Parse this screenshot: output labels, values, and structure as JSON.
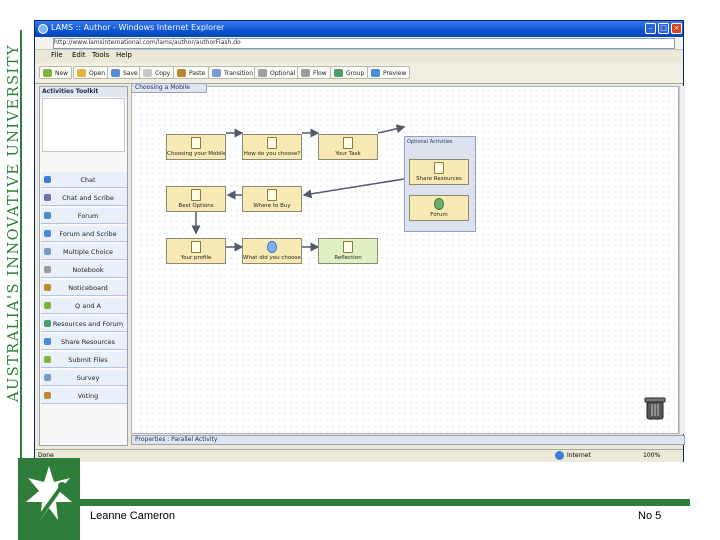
{
  "branding": {
    "university": "AUSTRALIA'S INNOVATIVE UNIVERSITY",
    "logo_icon": "university-star-logo"
  },
  "footer": {
    "presenter": "Leanne Cameron",
    "slide_number": "No 5"
  },
  "browser": {
    "title": "LAMS :: Author - Windows Internet Explorer",
    "address": "http://www.lamsinternational.com/lams/author/authorFlash.do",
    "menu": [
      "File",
      "Edit",
      "Tools",
      "Help"
    ],
    "toolbar": [
      "New",
      "Open",
      "Save",
      "Copy",
      "Paste",
      "Transition",
      "Optional",
      "Flow",
      "Group",
      "Preview"
    ],
    "status_left": "Done",
    "status_zone": "Internet",
    "zoom": "100%"
  },
  "toolkit": {
    "title": "Activities Toolkit",
    "items": [
      {
        "label": "Chat",
        "icon": "chat-icon",
        "color": "#3b7dd8"
      },
      {
        "label": "Chat and Scribe",
        "icon": "scribe-icon",
        "color": "#6f6fb8"
      },
      {
        "label": "Forum",
        "icon": "forum-icon",
        "color": "#4a8bd6"
      },
      {
        "label": "Forum and Scribe",
        "icon": "forum-scribe-icon",
        "color": "#4a8bd6"
      },
      {
        "label": "Multiple Choice",
        "icon": "mcq-icon",
        "color": "#7a9ac8"
      },
      {
        "label": "Notebook",
        "icon": "notebook-icon",
        "color": "#9c9c9c"
      },
      {
        "label": "Noticeboard",
        "icon": "noticeboard-icon",
        "color": "#c28a2e"
      },
      {
        "label": "Q and A",
        "icon": "qa-icon",
        "color": "#7fb33a"
      },
      {
        "label": "Resources and Forum",
        "icon": "resources-forum-icon",
        "color": "#4f9a6a"
      },
      {
        "label": "Share Resources",
        "icon": "share-resources-icon",
        "color": "#4a8bd6"
      },
      {
        "label": "Submit Files",
        "icon": "submit-files-icon",
        "color": "#7fb33a"
      },
      {
        "label": "Survey",
        "icon": "survey-icon",
        "color": "#7a9ac8"
      },
      {
        "label": "Voting",
        "icon": "voting-icon",
        "color": "#c28a2e"
      }
    ]
  },
  "canvas": {
    "tab_label": "Choosing a Mobile",
    "activities": [
      {
        "label": "Choosing your Mobile",
        "icon": "notebook-icon"
      },
      {
        "label": "How do you choose?",
        "icon": "document-icon"
      },
      {
        "label": "Your Task",
        "icon": "notebook-icon"
      },
      {
        "label": "Best Options",
        "icon": "document-icon"
      },
      {
        "label": "Where to Buy",
        "icon": "document-icon"
      },
      {
        "label": "Your profile",
        "icon": "document-icon"
      },
      {
        "label": "What did you choose?",
        "icon": "chat-icon"
      },
      {
        "label": "Reflection",
        "icon": "notebook-icon"
      }
    ],
    "optional_group": {
      "title": "Optional Activities",
      "items": [
        {
          "label": "Share Resources",
          "icon": "document-icon"
        },
        {
          "label": "Forum",
          "icon": "forum-icon"
        }
      ]
    },
    "trash_icon": "trash-icon"
  },
  "properties": {
    "label": "Properties : Parallel Activity"
  }
}
